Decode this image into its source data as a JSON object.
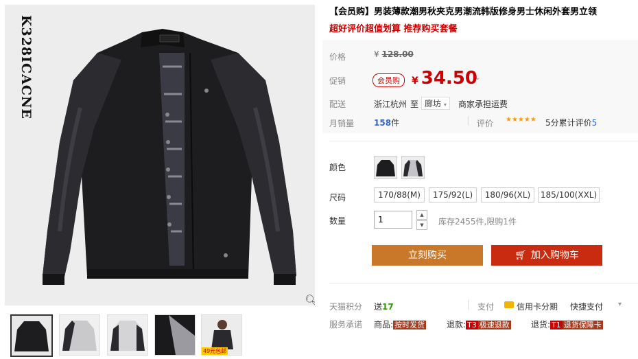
{
  "gallery": {
    "vertical_code": "K328ICACNE",
    "thumb_badge": "49元包邮"
  },
  "product": {
    "title": "【会员购】男装薄款潮男秋夹克男潮流韩版修身男士休闲外套男立领",
    "subtitle": "超好评价超值划算 推荐购买套餐"
  },
  "price": {
    "original_label": "价格",
    "original_currency": "¥",
    "original_amount": "128.00",
    "promo_label": "促销",
    "member_tag": "会员购",
    "promo_currency": "¥",
    "promo_amount": "34.50"
  },
  "shipping": {
    "label": "配送",
    "from": "浙江杭州",
    "to_word": "至",
    "destination": "廊坊",
    "fee": "商家承担运费"
  },
  "sales": {
    "label": "月销量",
    "count": "158",
    "unit": "件",
    "review_label": "评价",
    "stars": "★★★★★",
    "score": "5分",
    "review_text": "累计评价",
    "review_count": "5"
  },
  "sku": {
    "color_label": "颜色",
    "size_label": "尺码",
    "sizes": [
      "170/88(M)",
      "175/92(L)",
      "180/96(XL)",
      "185/100(XXL)"
    ],
    "qty_label": "数量",
    "qty_value": "1",
    "stock": "库存2455件,限购1件"
  },
  "actions": {
    "buy_now": "立刻购买",
    "add_to_cart": "加入购物车"
  },
  "extras": {
    "points_label": "天猫积分",
    "points_prefix": "送",
    "points_value": "17",
    "pay_label": "支付",
    "pay_installment": "信用卡分期",
    "pay_fast": "快捷支付",
    "promise_label": "服务承诺",
    "promise_goods": "商品:",
    "promise_goods_tag": "按时发货",
    "promise_refund": "退款:",
    "promise_refund_badge": "T3",
    "promise_refund_tag": "极速退款",
    "promise_return": "退货:",
    "promise_return_badge": "T1",
    "promise_return_tag": "退货保障卡"
  },
  "colors": {
    "buy_button": "#c9782a",
    "cart_button": "#c92b10",
    "price_red": "#cc0000"
  }
}
